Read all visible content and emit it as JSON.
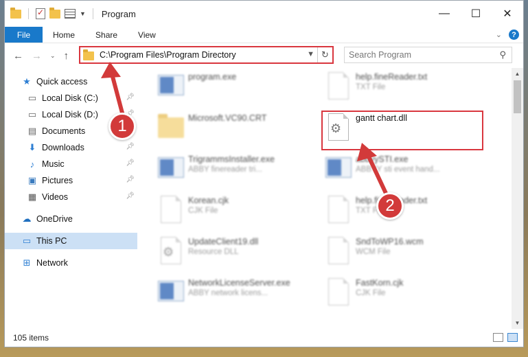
{
  "window": {
    "title": "Program",
    "controls": {
      "minimize": "—",
      "maximize": "☐",
      "close": "✕"
    }
  },
  "ribbon": {
    "tabs": [
      "File",
      "Home",
      "Share",
      "View"
    ]
  },
  "address": {
    "path": "C:\\Program Files\\Program Directory",
    "search_placeholder": "Search Program"
  },
  "sidebar": {
    "quick_access": "Quick access",
    "items": [
      {
        "label": "Local Disk (C:)",
        "icon": "disk-icon",
        "pinned": true
      },
      {
        "label": "Local Disk (D:)",
        "icon": "disk-icon",
        "pinned": true
      },
      {
        "label": "Documents",
        "icon": "documents-icon",
        "pinned": true
      },
      {
        "label": "Downloads",
        "icon": "downloads-icon",
        "pinned": true
      },
      {
        "label": "Music",
        "icon": "music-icon",
        "pinned": true
      },
      {
        "label": "Pictures",
        "icon": "pictures-icon",
        "pinned": true
      },
      {
        "label": "Videos",
        "icon": "videos-icon",
        "pinned": true
      }
    ],
    "onedrive": "OneDrive",
    "this_pc": "This PC",
    "network": "Network"
  },
  "files": [
    {
      "name": "program.exe",
      "type": "",
      "icon": "exe"
    },
    {
      "name": "help.fineReader.txt",
      "type": "TXT File",
      "icon": "doc"
    },
    {
      "name": "Microsoft.VC90.CRT",
      "type": "",
      "icon": "folder"
    },
    {
      "name": "gantt chart.dll",
      "type": "",
      "icon": "dll",
      "highlighted": true
    },
    {
      "name": "TrigrammsInstaller.exe",
      "type": "ABBY finereader tri...",
      "icon": "exe"
    },
    {
      "name": "abbyySTI.exe",
      "type": "ABBYY sti event hand...",
      "icon": "exe"
    },
    {
      "name": "Korean.cjk",
      "type": "CJK File",
      "icon": "doc"
    },
    {
      "name": "help.fineReader.txt",
      "type": "TXT File",
      "icon": "doc"
    },
    {
      "name": "UpdateClient19.dll",
      "type": "Resource DLL",
      "icon": "dll"
    },
    {
      "name": "SndToWP16.wcm",
      "type": "WCM File",
      "icon": "doc"
    },
    {
      "name": "NetworkLicenseServer.exe",
      "type": "ABBY network licens...",
      "icon": "exe"
    },
    {
      "name": "FastKorn.cjk",
      "type": "CJK File",
      "icon": "doc"
    }
  ],
  "annotations": {
    "badge1": "1",
    "badge2": "2",
    "color": "#d23a3a"
  },
  "status": {
    "item_count": "105 items"
  },
  "colors": {
    "accent": "#1979ca",
    "highlight": "#d9363e",
    "selection": "#cce0f5"
  }
}
